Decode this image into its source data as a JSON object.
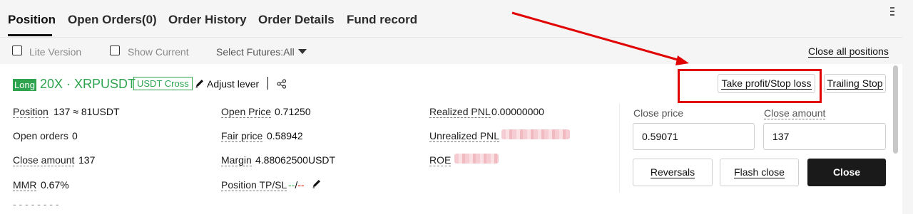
{
  "tabs": [
    {
      "label": "Position"
    },
    {
      "label": "Open Orders(0)"
    },
    {
      "label": "Order History"
    },
    {
      "label": "Order Details"
    },
    {
      "label": "Fund record"
    }
  ],
  "filters": {
    "lite_version": "Lite Version",
    "show_current": "Show Current",
    "select_futures": "Select Futures:All",
    "close_all": "Close all positions"
  },
  "position": {
    "side": "Long",
    "symbol": "20X · XRPUSDT",
    "margin_mode": "USDT Cross",
    "adjust_lever": "Adjust lever"
  },
  "fields": {
    "position_label": "Position",
    "position_value": "137 ≈ 81USDT",
    "open_orders_label": "Open orders",
    "open_orders_value": "0",
    "close_amount_label": "Close amount",
    "close_amount_value": "137",
    "mmr_label": "MMR",
    "mmr_value": "0.67%",
    "open_price_label": "Open Price",
    "open_price_value": "0.71250",
    "fair_price_label": "Fair price",
    "fair_price_value": "0.58942",
    "margin_label": "Margin",
    "margin_value": "4.88062500USDT",
    "tpsl_label": "Position TP/SL",
    "tpsl_tp": "--",
    "tpsl_sep": "/",
    "tpsl_sl": "--",
    "realized_label": "Realized PNL",
    "realized_value": "0.00000000",
    "unrealized_label": "Unrealized PNL",
    "roe_label": "ROE"
  },
  "actions": {
    "tp_sl": "Take profit/Stop loss",
    "trailing_stop": "Trailing Stop",
    "close_price_label": "Close price",
    "close_price_value": "0.59071",
    "close_amount_label": "Close amount",
    "close_amount_value": "137",
    "reversals": "Reversals",
    "flash_close": "Flash close",
    "close": "Close"
  },
  "colors": {
    "long_green": "#2ea44f",
    "annotation_red": "#e10000",
    "dark_button": "#1a1a1a"
  }
}
